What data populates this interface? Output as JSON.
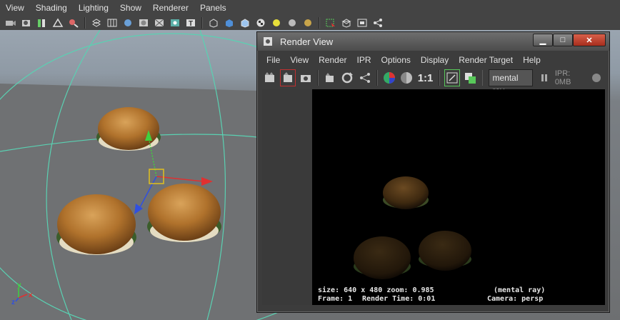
{
  "main_menu": [
    "View",
    "Shading",
    "Lighting",
    "Show",
    "Renderer",
    "Panels"
  ],
  "viewport": {
    "axis": {
      "x": "x",
      "y": "y",
      "z": "z"
    }
  },
  "render_view": {
    "title": "Render View",
    "window_buttons": {
      "minimize": "▁",
      "maximize": "□",
      "close": "✕"
    },
    "menu": [
      "File",
      "View",
      "Render",
      "IPR",
      "Options",
      "Display",
      "Render Target",
      "Help"
    ],
    "toolbar": {
      "ratio": "1:1",
      "renderer": "mental ray",
      "ipr": "IPR: 0MB"
    },
    "info": {
      "size": "size: 640 x 480 zoom: 0.985",
      "renderer": "(mental ray)",
      "frame": "Frame: 1",
      "render_time": "Render Time: 0:01",
      "camera": "Camera: persp"
    }
  },
  "colors": {
    "accent_green": "#58c85a",
    "selection_yellow": "#e0c020",
    "close_red": "#c0392b"
  }
}
